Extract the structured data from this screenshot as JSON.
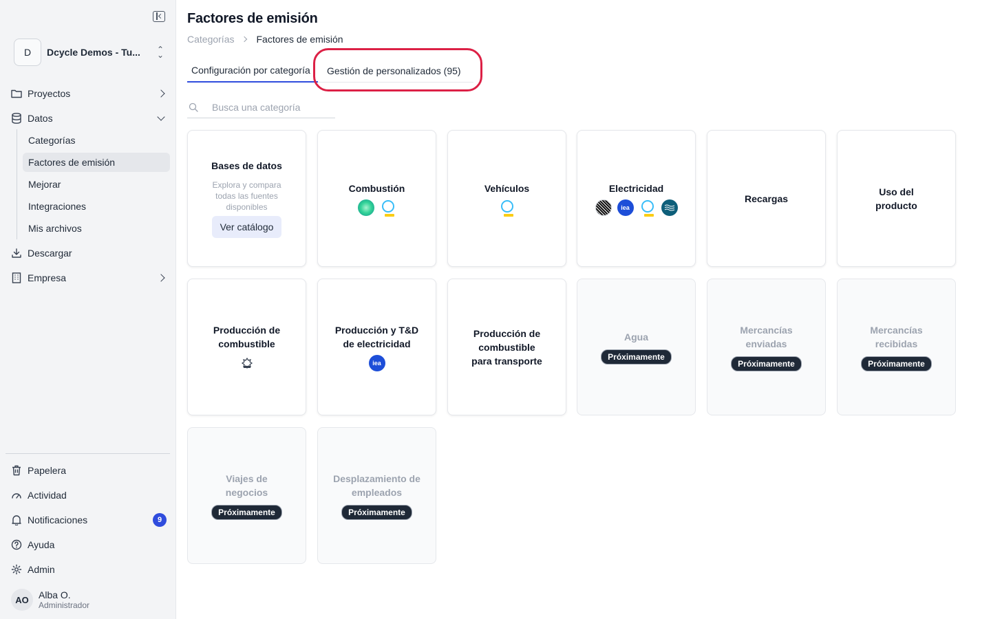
{
  "sidebar": {
    "org_initial": "D",
    "org_name": "Dcycle Demos - Tu...",
    "nav": {
      "projects": "Proyectos",
      "data": "Datos",
      "download": "Descargar",
      "company": "Empresa"
    },
    "data_sub": {
      "categories": "Categorías",
      "emission_factors": "Factores de emisión",
      "improve": "Mejorar",
      "integrations": "Integraciones",
      "my_files": "Mis archivos"
    },
    "bottom": {
      "trash": "Papelera",
      "activity": "Actividad",
      "notifications": "Notificaciones",
      "notifications_count": "9",
      "help": "Ayuda",
      "admin": "Admin"
    },
    "user": {
      "initials": "AO",
      "name": "Alba O.",
      "role": "Administrador"
    }
  },
  "main": {
    "title": "Factores de emisión",
    "breadcrumb": {
      "parent": "Categorías",
      "current": "Factores de emisión"
    },
    "tabs": {
      "config": "Configuración por categoría",
      "custom": "Gestión de personalizados (95)"
    },
    "search_placeholder": "Busca una categoría",
    "cards": {
      "databases": {
        "title": "Bases de datos",
        "desc": "Explora y compara todas las fuentes disponibles",
        "button": "Ver catálogo"
      },
      "combustion": "Combustión",
      "vehicles": "Vehículos",
      "electricity": "Electricidad",
      "recharges": "Recargas",
      "product_use": "Uso del producto",
      "fuel_production": "Producción de combustible",
      "electricity_production": "Producción y T&D de electricidad",
      "transport_fuel": "Producción de combustible para transporte",
      "water": "Agua",
      "goods_sent": "Mercancías enviadas",
      "goods_received": "Mercancías recibidas",
      "business_travel": "Viajes de negocios",
      "commuting": "Desplazamiento de empleados"
    },
    "coming_soon": "Próximamente",
    "iea_logo_text": "iea"
  },
  "colors": {
    "accent": "#2f4cdd",
    "highlight": "#dc2045"
  }
}
